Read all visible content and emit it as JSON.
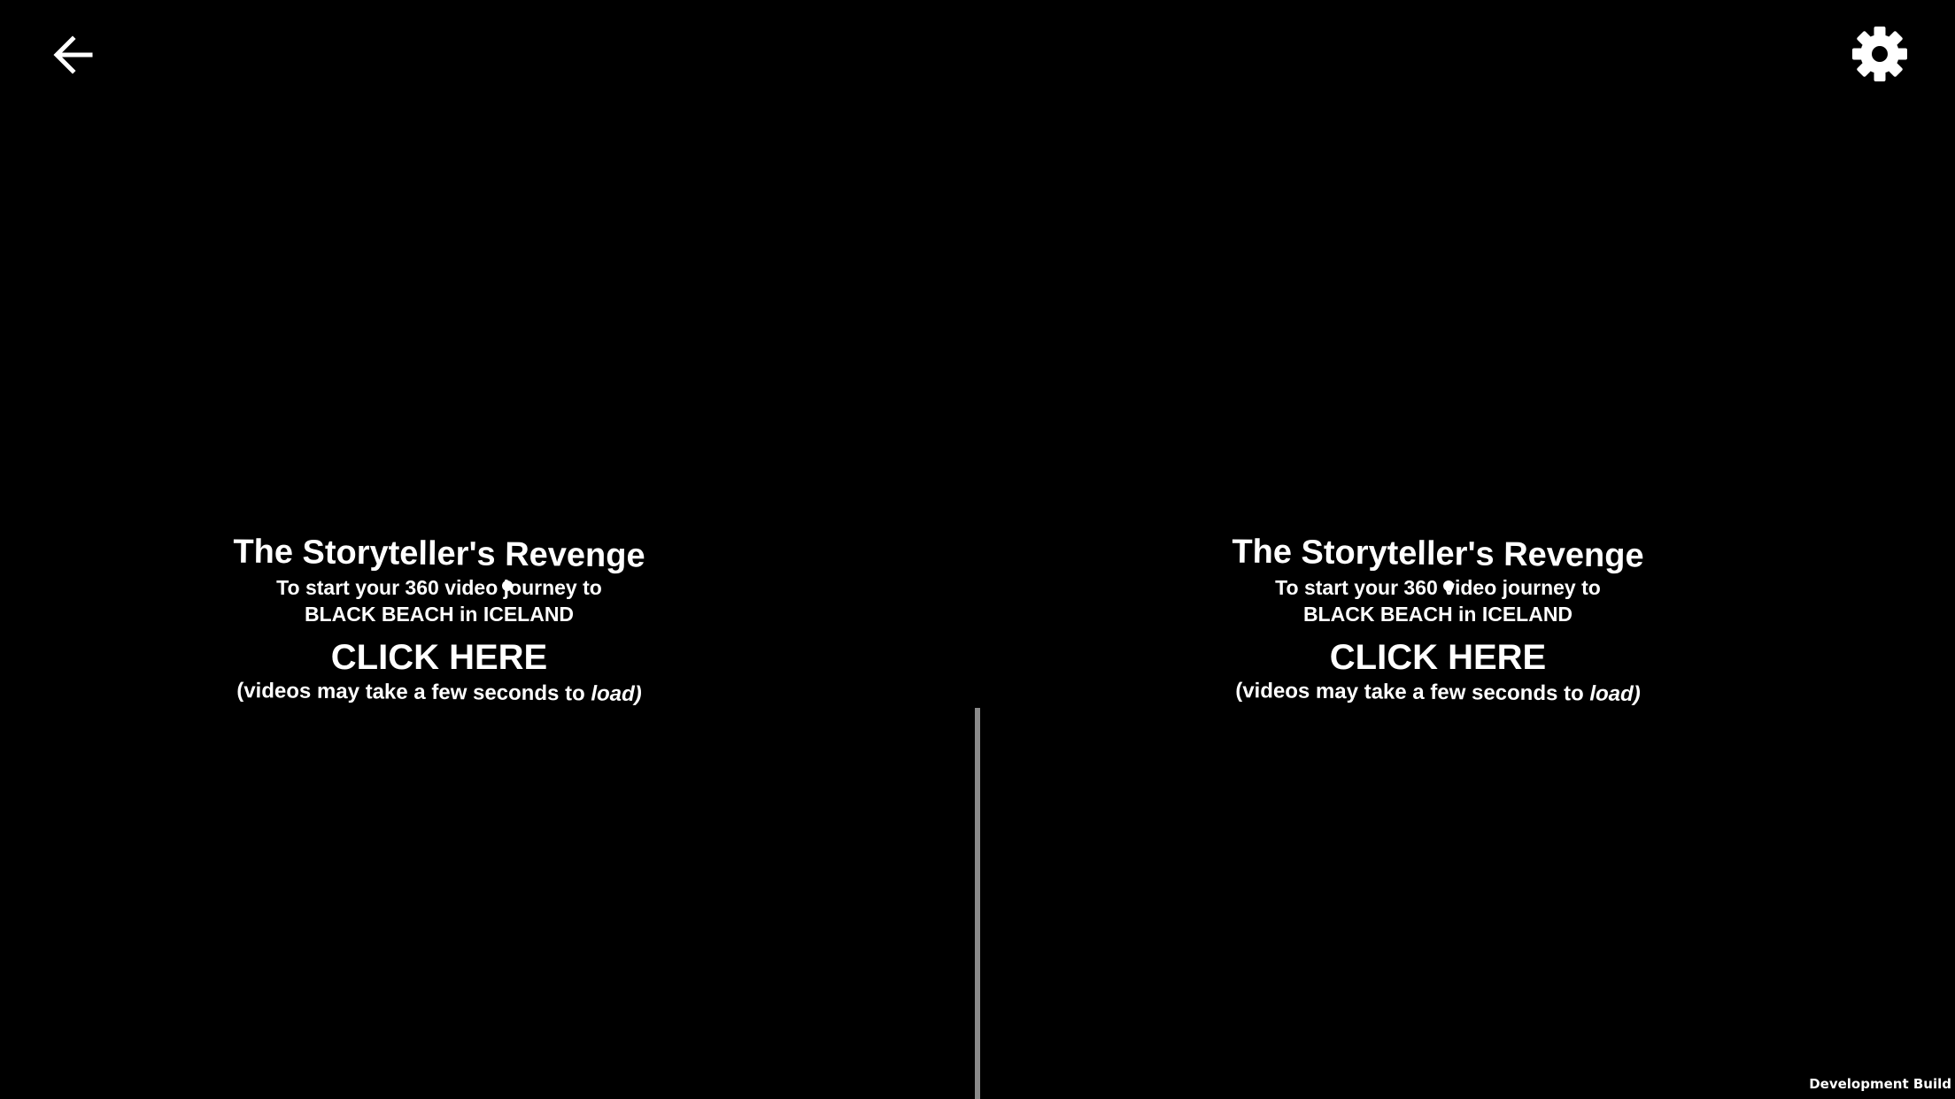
{
  "toolbar": {
    "back_icon": "arrow-left-icon",
    "settings_icon": "gear-icon"
  },
  "views": {
    "left": {
      "title": "The Storyteller's Revenge",
      "line1": "To start your 360 video journey to",
      "line2": "BLACK BEACH in ICELAND",
      "cta": "CLICK HERE",
      "note_prefix": "(videos may take a few seconds to ",
      "note_italic": "load)"
    },
    "right": {
      "title": "The Storyteller's Revenge",
      "line1": "To start your 360 video journey to",
      "line2": "BLACK BEACH in ICELAND",
      "cta": "CLICK HERE",
      "note_prefix": "(videos may take a few seconds to ",
      "note_italic": "load)"
    }
  },
  "footer": {
    "build_label": "Development Build"
  },
  "colors": {
    "background": "#000000",
    "text": "#ffffff",
    "divider": "#8a8a8a"
  }
}
